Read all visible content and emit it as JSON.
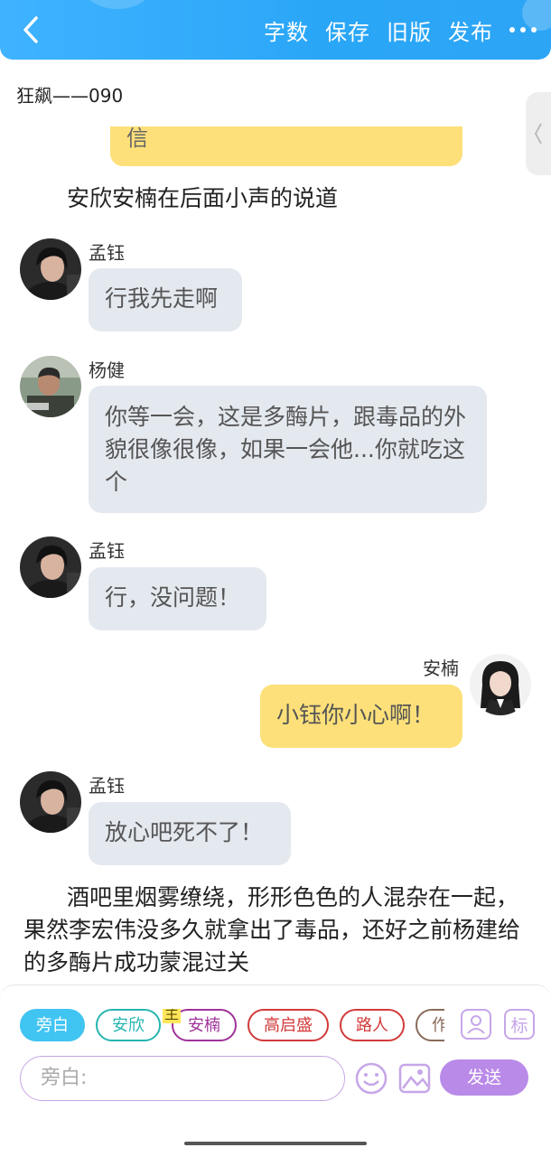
{
  "header": {
    "actions": [
      "字数",
      "保存",
      "旧版",
      "发布"
    ]
  },
  "chapter": {
    "title": "狂飙——090"
  },
  "chat": {
    "partial_bubble": "信",
    "narration_1": "安欣安楠在后面小声的说道",
    "messages": [
      {
        "speaker": "孟钰",
        "text": "行我先走啊",
        "side": "left"
      },
      {
        "speaker": "杨健",
        "text": "你等一会，这是多酶片，跟毒品的外貌很像很像，如果一会他...你就吃这个",
        "side": "left"
      },
      {
        "speaker": "孟钰",
        "text": "行，没问题！",
        "side": "left"
      },
      {
        "speaker": "安楠",
        "text": "小钰你小心啊！",
        "side": "right"
      },
      {
        "speaker": "孟钰",
        "text": "放心吧死不了！",
        "side": "left"
      }
    ],
    "narration_2": "酒吧里烟雾缭绕，形形色色的人混杂在一起，果然李宏伟没多久就拿出了毒品，还好之前杨建给的多酶片成功蒙混过关"
  },
  "composer": {
    "roles": [
      "旁白",
      "安欣",
      "安楠",
      "高启盛",
      "路人",
      "作"
    ],
    "active_role": "旁白",
    "main_badge": "主",
    "mark_label": "标",
    "input_placeholder": "旁白:",
    "send_label": "发送"
  },
  "colors": {
    "header": "#2aa6f7",
    "left_bubble": "#e4e8ef",
    "right_bubble": "#fde07a",
    "send_button": "#b98ae8",
    "active_chip": "#40c4f2"
  }
}
